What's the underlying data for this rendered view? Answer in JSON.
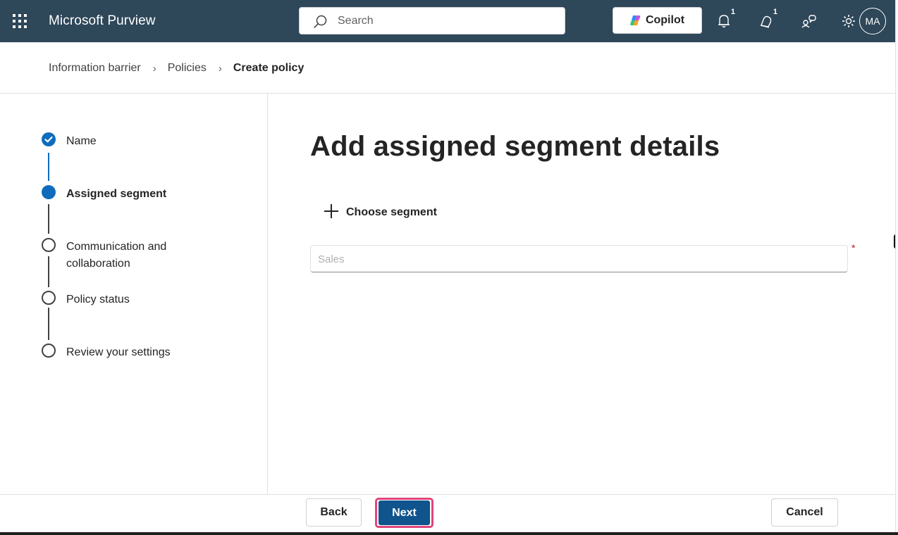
{
  "header": {
    "app_title": "Microsoft Purview",
    "search_placeholder": "Search",
    "copilot_label": "Copilot",
    "notification_count_1": "1",
    "notification_count_2": "1",
    "avatar_initials": "MA",
    "bg_color": "#2e4759"
  },
  "breadcrumb": {
    "items": [
      "Information barrier",
      "Policies"
    ],
    "current": "Create policy"
  },
  "steps": [
    {
      "label": "Name",
      "state": "completed"
    },
    {
      "label": "Assigned segment",
      "state": "current"
    },
    {
      "label": "Communication and collaboration",
      "state": "pending"
    },
    {
      "label": "Policy status",
      "state": "pending"
    },
    {
      "label": "Review your settings",
      "state": "pending"
    }
  ],
  "main": {
    "title": "Add assigned segment details",
    "choose_segment_label": "Choose segment",
    "segment_field_placeholder": "Sales",
    "required_marker": "*"
  },
  "footer": {
    "back_label": "Back",
    "next_label": "Next",
    "cancel_label": "Cancel"
  },
  "colors": {
    "accent": "#0f6cbd",
    "primary_button": "#0f548c",
    "highlight": "#e0457b",
    "required": "#c50f1f"
  }
}
